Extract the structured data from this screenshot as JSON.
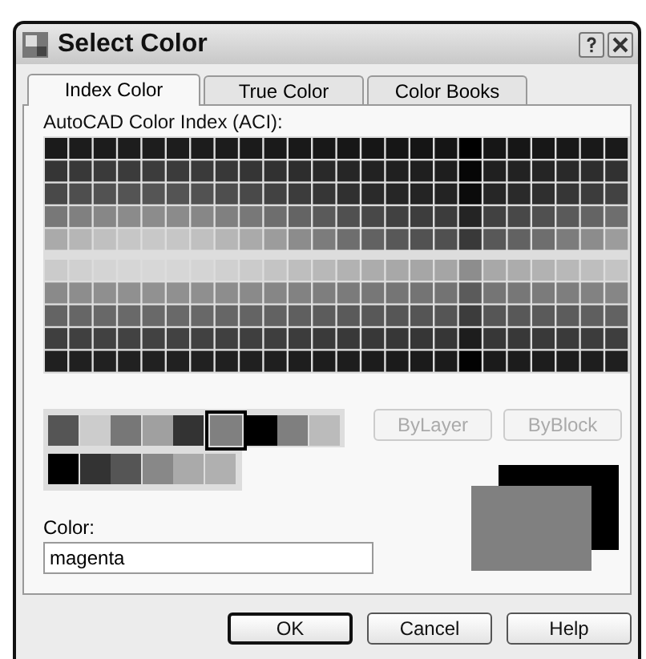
{
  "window": {
    "title": "Select Color"
  },
  "tabs": [
    {
      "label": "Index Color",
      "selected": true
    },
    {
      "label": "True Color",
      "selected": false
    },
    {
      "label": "Color Books",
      "selected": false
    }
  ],
  "aci_label": "AutoCAD Color Index (ACI):",
  "standard_colors": [
    {
      "color": "#555555",
      "selected": false
    },
    {
      "color": "#cccccc",
      "selected": false
    },
    {
      "color": "#777777",
      "selected": false
    },
    {
      "color": "#a0a0a0",
      "selected": false
    },
    {
      "color": "#333333",
      "selected": false
    },
    {
      "color": "#808080",
      "selected": true
    },
    {
      "color": "#000000",
      "selected": false
    },
    {
      "color": "#7f7f7f",
      "selected": false
    },
    {
      "color": "#bbbbbb",
      "selected": false
    }
  ],
  "gray_colors": [
    {
      "color": "#000000",
      "selected": false
    },
    {
      "color": "#333333",
      "selected": false
    },
    {
      "color": "#555555",
      "selected": false
    },
    {
      "color": "#888888",
      "selected": false
    },
    {
      "color": "#aaaaaa",
      "selected": false
    },
    {
      "color": "#b0b0b0",
      "selected": false
    }
  ],
  "by_buttons": [
    {
      "label": "ByLayer",
      "disabled": true
    },
    {
      "label": "ByBlock",
      "disabled": true
    }
  ],
  "color_field": {
    "label": "Color:",
    "value": "magenta"
  },
  "buttons": [
    {
      "label": "OK",
      "default": true
    },
    {
      "label": "Cancel",
      "default": false
    },
    {
      "label": "Help",
      "default": false
    }
  ]
}
